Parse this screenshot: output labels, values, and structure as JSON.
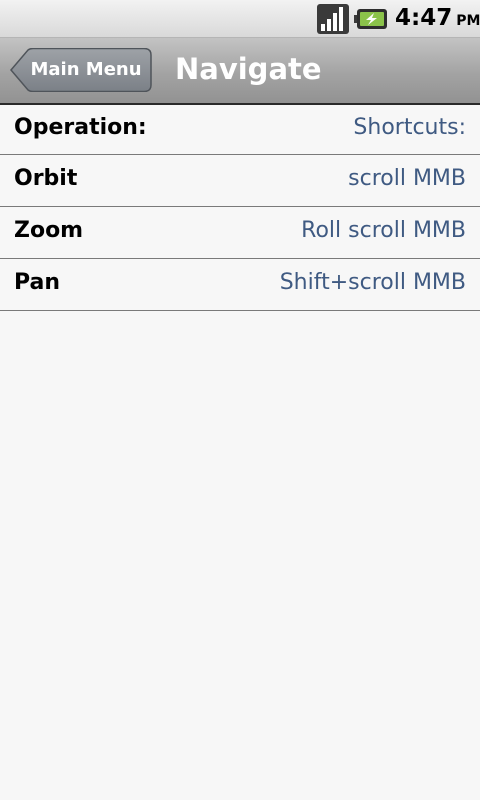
{
  "status_bar": {
    "time": "4:47",
    "ampm": "PM",
    "icons": [
      "signal-icon",
      "battery-charging-icon"
    ],
    "battery_accent": "#8bc34a"
  },
  "title_bar": {
    "back_label": "Main Menu",
    "title": "Navigate"
  },
  "table": {
    "header": {
      "operation": "Operation:",
      "shortcut": "Shortcuts:"
    },
    "rows": [
      {
        "operation": "Orbit",
        "shortcut": "scroll MMB"
      },
      {
        "operation": "Zoom",
        "shortcut": "Roll scroll MMB"
      },
      {
        "operation": "Pan",
        "shortcut": "Shift+scroll MMB"
      }
    ]
  },
  "colors": {
    "shortcut_text": "#3f5a82",
    "background": "#f7f7f7"
  }
}
